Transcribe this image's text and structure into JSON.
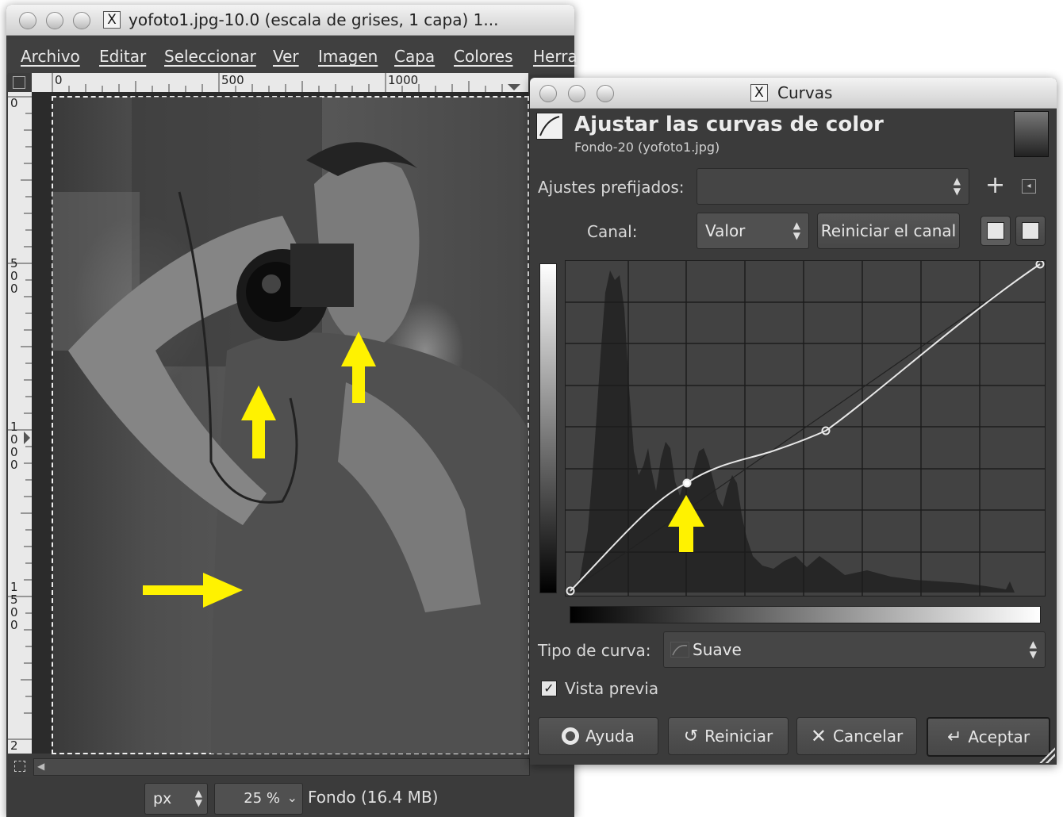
{
  "image_window": {
    "title": "yofoto1.jpg-10.0 (escala de grises, 1 capa) 1...",
    "menu": [
      "Archivo",
      "Editar",
      "Seleccionar",
      "Ver",
      "Imagen",
      "Capa",
      "Colores",
      "Herra"
    ],
    "ruler_h_labels": [
      "0",
      "500",
      "1000"
    ],
    "ruler_v_labels": [
      "0",
      "500",
      "1000",
      "1500",
      "2"
    ],
    "status": {
      "unit": "px",
      "zoom": "25 %",
      "layer_info": "Fondo (16.4 MB)"
    }
  },
  "curves_dialog": {
    "window_title": "Curvas",
    "heading": "Ajustar las curvas de color",
    "subheading": "Fondo-20 (yofoto1.jpg)",
    "presets_label": "Ajustes prefijados:",
    "presets_value": "",
    "channel_label": "Canal:",
    "channel_value": "Valor",
    "reset_channel_label": "Reiniciar el canal",
    "curve_type_label": "Tipo de curva:",
    "curve_type_value": "Suave",
    "preview_label": "Vista previa",
    "preview_checked": true,
    "buttons": {
      "help": "Ayuda",
      "reset": "Reiniciar",
      "cancel": "Cancelar",
      "ok": "Aceptar"
    },
    "icons": {
      "add": "plus-icon",
      "menu": "panel-menu-icon",
      "linear_hist": "linear-histogram-icon",
      "log_hist": "log-histogram-icon"
    }
  },
  "annotations": {
    "arrow_color": "#fff200"
  }
}
